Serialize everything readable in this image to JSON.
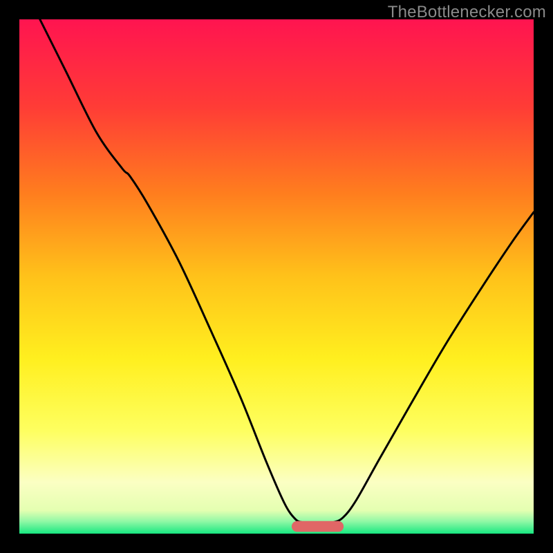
{
  "watermark": "TheBottlenecker.com",
  "chart_data": {
    "type": "line",
    "title": "",
    "xlabel": "",
    "ylabel": "",
    "xlim": [
      0,
      100
    ],
    "ylim": [
      0,
      100
    ],
    "gradient_stops": [
      {
        "offset": 0.0,
        "color": "#ff1450"
      },
      {
        "offset": 0.17,
        "color": "#ff3c36"
      },
      {
        "offset": 0.34,
        "color": "#ff7e1e"
      },
      {
        "offset": 0.5,
        "color": "#ffc21a"
      },
      {
        "offset": 0.66,
        "color": "#ffef1f"
      },
      {
        "offset": 0.8,
        "color": "#feff60"
      },
      {
        "offset": 0.9,
        "color": "#fbffc3"
      },
      {
        "offset": 0.955,
        "color": "#e4ffb1"
      },
      {
        "offset": 0.976,
        "color": "#91f8a6"
      },
      {
        "offset": 1.0,
        "color": "#17e880"
      }
    ],
    "curve": [
      {
        "x": 4.0,
        "y": 100.0
      },
      {
        "x": 9.0,
        "y": 90.0
      },
      {
        "x": 15.0,
        "y": 78.0
      },
      {
        "x": 20.0,
        "y": 71.0
      },
      {
        "x": 21.5,
        "y": 69.5
      },
      {
        "x": 25.0,
        "y": 64.0
      },
      {
        "x": 31.0,
        "y": 53.0
      },
      {
        "x": 37.0,
        "y": 40.0
      },
      {
        "x": 43.0,
        "y": 26.5
      },
      {
        "x": 48.0,
        "y": 14.0
      },
      {
        "x": 51.5,
        "y": 6.0
      },
      {
        "x": 53.5,
        "y": 3.0
      },
      {
        "x": 55.0,
        "y": 2.2
      },
      {
        "x": 58.0,
        "y": 2.0
      },
      {
        "x": 61.0,
        "y": 2.2
      },
      {
        "x": 63.0,
        "y": 3.2
      },
      {
        "x": 65.5,
        "y": 6.5
      },
      {
        "x": 70.0,
        "y": 14.5
      },
      {
        "x": 76.0,
        "y": 25.0
      },
      {
        "x": 83.0,
        "y": 37.0
      },
      {
        "x": 90.0,
        "y": 48.0
      },
      {
        "x": 96.0,
        "y": 57.0
      },
      {
        "x": 100.0,
        "y": 62.5
      }
    ],
    "marker": {
      "x_start": 54.0,
      "x_end": 62.0,
      "y": 1.4,
      "color": "#e06666",
      "thickness": 2.1
    }
  }
}
